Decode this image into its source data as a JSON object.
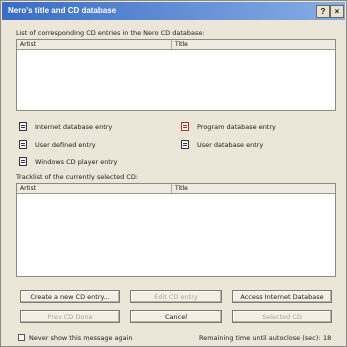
{
  "window": {
    "title": "Nero's title and CD database"
  },
  "titlebar_buttons": {
    "help": "?",
    "close": "×"
  },
  "top_list": {
    "label": "List of corresponding CD entries in the Nero CD database:",
    "columns": [
      "Artist",
      "Title"
    ]
  },
  "legend": {
    "internet": "Internet database entry",
    "program": "Program database entry",
    "user_defined": "User defined entry",
    "user_db": "User database entry",
    "windows": "Windows CD player entry"
  },
  "tracklist": {
    "label": "Tracklist of the currently selected CD:",
    "columns": [
      "Artist",
      "Title"
    ]
  },
  "buttons": {
    "create": "Create a new CD entry...",
    "edit": "Edit CD entry",
    "access": "Access Internet Database",
    "prev": "Prev CD Done",
    "cancel": "Cancel",
    "selected": "Selected CD"
  },
  "footer": {
    "never_show": "Never show this message again",
    "remaining_label": "Remaining time until autoclose (sec):",
    "remaining_value": "18"
  }
}
